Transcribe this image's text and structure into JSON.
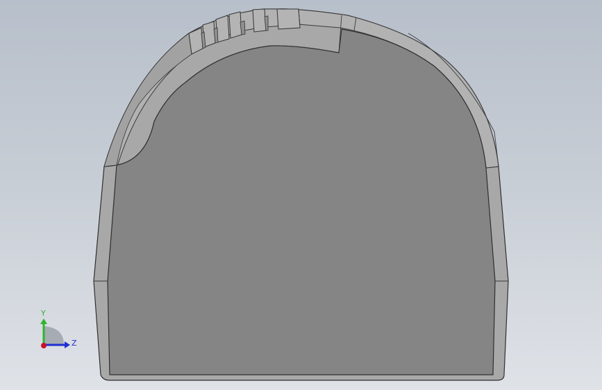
{
  "viewport": {
    "background_top": "#b7bfca",
    "background_bottom": "#dfe2e7"
  },
  "model": {
    "face_color": "#858585",
    "rim_color": "#a9a9a9",
    "edge_color": "#2e2e2e",
    "tab_count": 6
  },
  "triad": {
    "y_label": "Y",
    "z_label": "Z",
    "y_color": "#2db52d",
    "z_color": "#1f2fd0",
    "x_color": "#c8102e"
  }
}
